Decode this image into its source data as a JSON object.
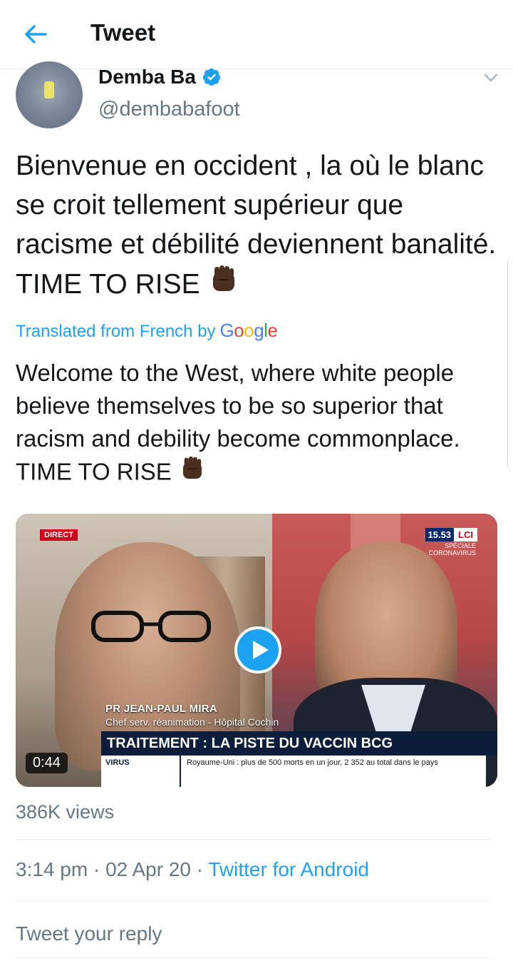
{
  "header": {
    "title": "Tweet"
  },
  "author": {
    "name": "Demba Ba",
    "handle": "@dembabafoot"
  },
  "tweet": {
    "text": "Bienvenue en occident , la où le blanc se croit tellement supérieur que racisme et débilité deviennent banalité. TIME TO RISE",
    "translated_label": "Translated from French by",
    "translation_provider": "Google",
    "translation": "Welcome to the West, where white people believe themselves to be so superior that racism and debility become commonplace. TIME TO RISE"
  },
  "media": {
    "duration": "0:44",
    "overlay": {
      "direct": "DIRECT",
      "time": "15.53",
      "channel": "LCI",
      "special": "SPÉCIALE CORONAVIRUS",
      "person_name": "PR JEAN-PAUL MIRA",
      "person_role": "Chef serv. réanimation - Hôpital Cochin",
      "headline": "TRAITEMENT : LA PISTE DU VACCIN BCG",
      "ticker_tag": "VIRUS",
      "ticker_text": "Royaume-Uni : plus de 500 morts en un jour, 2 352 au total dans le pays"
    }
  },
  "stats": {
    "views": "386K views"
  },
  "meta": {
    "time": "3:14 pm",
    "date": "02 Apr 20",
    "separator": "·",
    "source": "Twitter for Android"
  },
  "reply": {
    "placeholder": "Tweet your reply"
  },
  "colors": {
    "accent": "#1da1f2",
    "text": "#14171a",
    "muted": "#657786",
    "divider": "#e6ecf0"
  }
}
